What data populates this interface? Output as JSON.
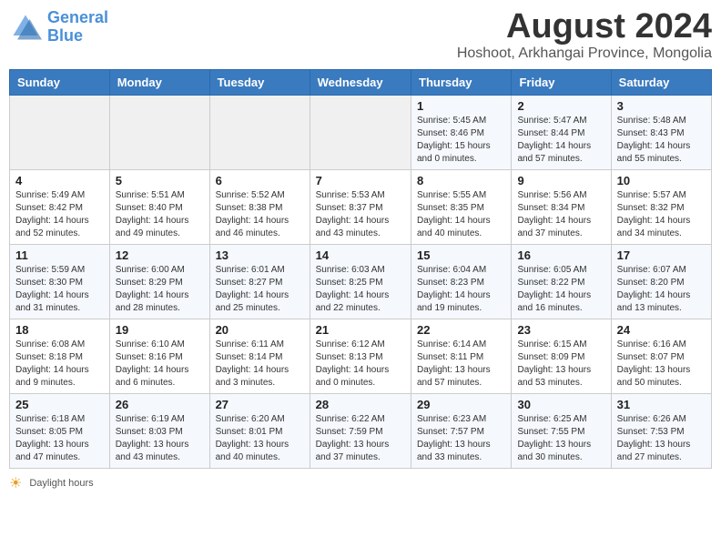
{
  "header": {
    "logo_line1": "General",
    "logo_line2": "Blue",
    "month_title": "August 2024",
    "location": "Hoshoot, Arkhangai Province, Mongolia"
  },
  "days_of_week": [
    "Sunday",
    "Monday",
    "Tuesday",
    "Wednesday",
    "Thursday",
    "Friday",
    "Saturday"
  ],
  "weeks": [
    [
      {
        "num": "",
        "info": ""
      },
      {
        "num": "",
        "info": ""
      },
      {
        "num": "",
        "info": ""
      },
      {
        "num": "",
        "info": ""
      },
      {
        "num": "1",
        "info": "Sunrise: 5:45 AM\nSunset: 8:46 PM\nDaylight: 15 hours\nand 0 minutes."
      },
      {
        "num": "2",
        "info": "Sunrise: 5:47 AM\nSunset: 8:44 PM\nDaylight: 14 hours\nand 57 minutes."
      },
      {
        "num": "3",
        "info": "Sunrise: 5:48 AM\nSunset: 8:43 PM\nDaylight: 14 hours\nand 55 minutes."
      }
    ],
    [
      {
        "num": "4",
        "info": "Sunrise: 5:49 AM\nSunset: 8:42 PM\nDaylight: 14 hours\nand 52 minutes."
      },
      {
        "num": "5",
        "info": "Sunrise: 5:51 AM\nSunset: 8:40 PM\nDaylight: 14 hours\nand 49 minutes."
      },
      {
        "num": "6",
        "info": "Sunrise: 5:52 AM\nSunset: 8:38 PM\nDaylight: 14 hours\nand 46 minutes."
      },
      {
        "num": "7",
        "info": "Sunrise: 5:53 AM\nSunset: 8:37 PM\nDaylight: 14 hours\nand 43 minutes."
      },
      {
        "num": "8",
        "info": "Sunrise: 5:55 AM\nSunset: 8:35 PM\nDaylight: 14 hours\nand 40 minutes."
      },
      {
        "num": "9",
        "info": "Sunrise: 5:56 AM\nSunset: 8:34 PM\nDaylight: 14 hours\nand 37 minutes."
      },
      {
        "num": "10",
        "info": "Sunrise: 5:57 AM\nSunset: 8:32 PM\nDaylight: 14 hours\nand 34 minutes."
      }
    ],
    [
      {
        "num": "11",
        "info": "Sunrise: 5:59 AM\nSunset: 8:30 PM\nDaylight: 14 hours\nand 31 minutes."
      },
      {
        "num": "12",
        "info": "Sunrise: 6:00 AM\nSunset: 8:29 PM\nDaylight: 14 hours\nand 28 minutes."
      },
      {
        "num": "13",
        "info": "Sunrise: 6:01 AM\nSunset: 8:27 PM\nDaylight: 14 hours\nand 25 minutes."
      },
      {
        "num": "14",
        "info": "Sunrise: 6:03 AM\nSunset: 8:25 PM\nDaylight: 14 hours\nand 22 minutes."
      },
      {
        "num": "15",
        "info": "Sunrise: 6:04 AM\nSunset: 8:23 PM\nDaylight: 14 hours\nand 19 minutes."
      },
      {
        "num": "16",
        "info": "Sunrise: 6:05 AM\nSunset: 8:22 PM\nDaylight: 14 hours\nand 16 minutes."
      },
      {
        "num": "17",
        "info": "Sunrise: 6:07 AM\nSunset: 8:20 PM\nDaylight: 14 hours\nand 13 minutes."
      }
    ],
    [
      {
        "num": "18",
        "info": "Sunrise: 6:08 AM\nSunset: 8:18 PM\nDaylight: 14 hours\nand 9 minutes."
      },
      {
        "num": "19",
        "info": "Sunrise: 6:10 AM\nSunset: 8:16 PM\nDaylight: 14 hours\nand 6 minutes."
      },
      {
        "num": "20",
        "info": "Sunrise: 6:11 AM\nSunset: 8:14 PM\nDaylight: 14 hours\nand 3 minutes."
      },
      {
        "num": "21",
        "info": "Sunrise: 6:12 AM\nSunset: 8:13 PM\nDaylight: 14 hours\nand 0 minutes."
      },
      {
        "num": "22",
        "info": "Sunrise: 6:14 AM\nSunset: 8:11 PM\nDaylight: 13 hours\nand 57 minutes."
      },
      {
        "num": "23",
        "info": "Sunrise: 6:15 AM\nSunset: 8:09 PM\nDaylight: 13 hours\nand 53 minutes."
      },
      {
        "num": "24",
        "info": "Sunrise: 6:16 AM\nSunset: 8:07 PM\nDaylight: 13 hours\nand 50 minutes."
      }
    ],
    [
      {
        "num": "25",
        "info": "Sunrise: 6:18 AM\nSunset: 8:05 PM\nDaylight: 13 hours\nand 47 minutes."
      },
      {
        "num": "26",
        "info": "Sunrise: 6:19 AM\nSunset: 8:03 PM\nDaylight: 13 hours\nand 43 minutes."
      },
      {
        "num": "27",
        "info": "Sunrise: 6:20 AM\nSunset: 8:01 PM\nDaylight: 13 hours\nand 40 minutes."
      },
      {
        "num": "28",
        "info": "Sunrise: 6:22 AM\nSunset: 7:59 PM\nDaylight: 13 hours\nand 37 minutes."
      },
      {
        "num": "29",
        "info": "Sunrise: 6:23 AM\nSunset: 7:57 PM\nDaylight: 13 hours\nand 33 minutes."
      },
      {
        "num": "30",
        "info": "Sunrise: 6:25 AM\nSunset: 7:55 PM\nDaylight: 13 hours\nand 30 minutes."
      },
      {
        "num": "31",
        "info": "Sunrise: 6:26 AM\nSunset: 7:53 PM\nDaylight: 13 hours\nand 27 minutes."
      }
    ]
  ],
  "footer": {
    "note": "Daylight hours"
  }
}
